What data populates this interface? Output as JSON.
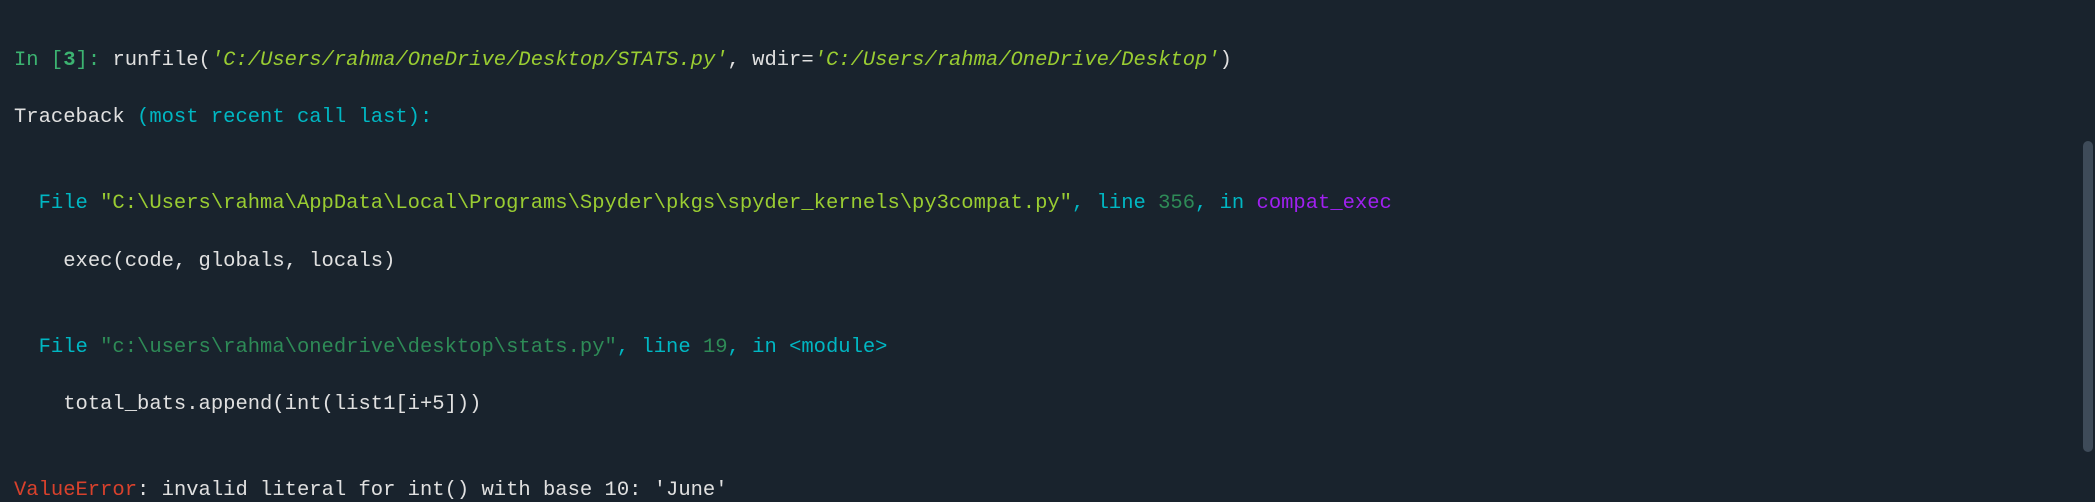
{
  "prompt": {
    "in_label": "In [",
    "in_num": "3",
    "in_close": "]: ",
    "call_fn": "runfile(",
    "arg1": "'C:/Users/rahma/OneDrive/Desktop/STATS.py'",
    "arg_sep": ", wdir=",
    "arg2": "'C:/Users/rahma/OneDrive/Desktop'",
    "call_close": ")"
  },
  "traceback_header": "Traceback ",
  "traceback_paren": "(most recent call last):",
  "blank": "",
  "frame1": {
    "indent": "  ",
    "file_word": "File ",
    "path": "\"C:\\Users\\rahma\\AppData\\Local\\Programs\\Spyder\\pkgs\\spyder_kernels\\py3compat.py\"",
    "line_sep": ", line ",
    "line_num": "356",
    "in_sep": ", in ",
    "fn": "compat_exec",
    "code_indent": "    ",
    "code": "exec(code, globals, locals)"
  },
  "frame2": {
    "indent": "  ",
    "file_word": "File ",
    "path": "\"c:\\users\\rahma\\onedrive\\desktop\\stats.py\"",
    "line_sep": ", line ",
    "line_num": "19",
    "in_sep": ", in ",
    "fn": "<module>",
    "code_indent": "    ",
    "code": "total_bats.append(int(list1[i+5]))"
  },
  "error": {
    "type": "ValueError",
    "colon": ":",
    "msg": " invalid literal for int() with base 10: 'June'"
  }
}
